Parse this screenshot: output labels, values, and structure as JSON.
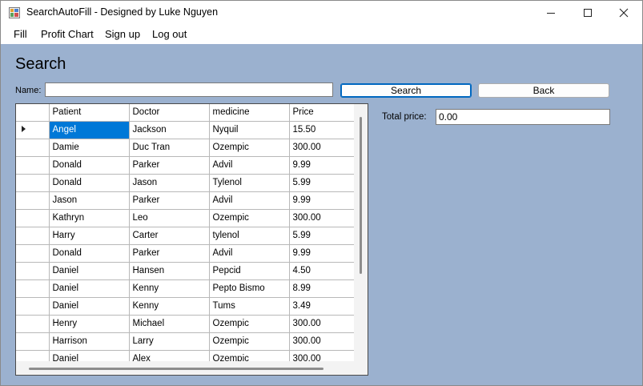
{
  "window": {
    "title": "SearchAutoFill - Designed by Luke Nguyen",
    "minimize_icon": "minimize-icon",
    "maximize_icon": "maximize-icon",
    "close_icon": "close-icon"
  },
  "menu": [
    "Fill",
    "Profit Chart",
    "Sign up",
    "Log out"
  ],
  "search": {
    "heading": "Search",
    "name_label": "Name:",
    "name_value": "",
    "search_button": "Search",
    "back_button": "Back"
  },
  "grid": {
    "columns": [
      "Patient",
      "Doctor",
      "medicine",
      "Price"
    ],
    "rows": [
      [
        "Angel",
        "Jackson",
        "Nyquil",
        "15.50"
      ],
      [
        "Damie",
        "Duc Tran",
        "Ozempic",
        "300.00"
      ],
      [
        "Donald",
        "Parker",
        "Advil",
        "9.99"
      ],
      [
        "Donald",
        "Jason",
        "Tylenol",
        "5.99"
      ],
      [
        "Jason",
        "Parker",
        "Advil",
        "9.99"
      ],
      [
        "Kathryn",
        "Leo",
        "Ozempic",
        "300.00"
      ],
      [
        "Harry",
        "Carter",
        "tylenol",
        "5.99"
      ],
      [
        "Donald",
        "Parker",
        "Advil",
        "9.99"
      ],
      [
        "Daniel",
        "Hansen",
        "Pepcid",
        "4.50"
      ],
      [
        "Daniel",
        "Kenny",
        "Pepto Bismo",
        "8.99"
      ],
      [
        "Daniel",
        "Kenny",
        "Tums",
        "3.49"
      ],
      [
        "Henry",
        "Michael",
        "Ozempic",
        "300.00"
      ],
      [
        "Harrison",
        "Larry",
        "Ozempic",
        "300.00"
      ],
      [
        "Daniel",
        "Alex",
        "Ozempic",
        "300.00"
      ]
    ],
    "selected_row": 0,
    "current_row_icon": "row-pointer-icon"
  },
  "total": {
    "label": "Total price:",
    "value": "0.00"
  },
  "colors": {
    "form_background": "#9bb1cf",
    "selection": "#0078d7"
  }
}
